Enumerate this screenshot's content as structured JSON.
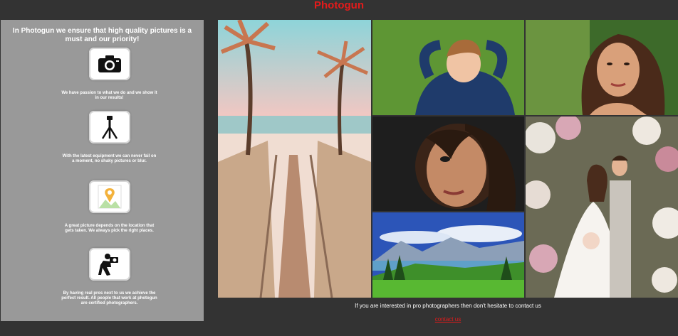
{
  "header": {
    "brand": "Photogun"
  },
  "sidebar": {
    "title": "In Photogun we ensure that high quality pictures is a must and our priority!",
    "features": [
      {
        "icon": "camera-icon",
        "text": "We have passion to what we do and we show it in our results!"
      },
      {
        "icon": "tripod-icon",
        "text": "With the latest equipment we can never fail on a moment, no shaky pictures or blur."
      },
      {
        "icon": "map-pin-icon",
        "text": "A great picture depends on the location that gets taken. We always pick the right places."
      },
      {
        "icon": "photographer-icon",
        "text": "By having real pros next to us we achieve the perfect result. All people that work at photogun are certified photographers."
      }
    ]
  },
  "gallery": {
    "photos": [
      "beach-boardwalk",
      "boy-on-grass",
      "woman-portrait",
      "woman-hair-face",
      "mountain-lake",
      "wedding-couple"
    ]
  },
  "cta": {
    "text": "If you are interested in pro photographers then don't hesitate to contact us",
    "link_label": "contact us"
  },
  "colors": {
    "background": "#333333",
    "brand": "#e31b1b",
    "sidebar": "#999999"
  }
}
